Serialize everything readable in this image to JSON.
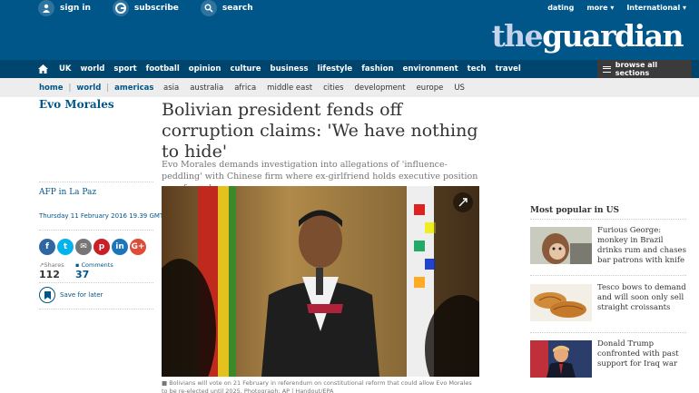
{
  "topnav": {
    "sign_in": "sign in",
    "subscribe": "subscribe",
    "search": "search",
    "dating": "dating",
    "more": "more",
    "international": "International"
  },
  "logo": {
    "the": "the",
    "guardian": "guardian"
  },
  "sections": [
    "UK",
    "world",
    "sport",
    "football",
    "opinion",
    "culture",
    "business",
    "lifestyle",
    "fashion",
    "environment",
    "tech",
    "travel"
  ],
  "browse_all": "browse all sections",
  "breadcrumb": [
    "home",
    "world",
    "americas"
  ],
  "subsections": [
    "asia",
    "australia",
    "africa",
    "middle east",
    "cities",
    "development",
    "europe",
    "US"
  ],
  "article": {
    "keyword": "Evo Morales",
    "headline": "Bolivian president fends off corruption claims: 'We have nothing to hide'",
    "standfirst": "Evo Morales demands investigation into allegations of 'influence-peddling' with Chinese firm where ex-girlfriend holds executive position as referendum nears",
    "byline": "AFP in La Paz",
    "date": "Thursday 11 February 2016 19.39 GMT",
    "caption": "Bolivians will vote on 21 February in referendum on constitutional reform that could allow Evo Morales to be re-elected until 2025. Photograph: AP | Handout/EPA"
  },
  "share": {
    "buttons": [
      "f",
      "t",
      "✉",
      "p",
      "in",
      "G+"
    ],
    "colors": [
      "#3067a3",
      "#03b3ee",
      "#767676",
      "#cb1f27",
      "#1b75bb",
      "#dd4b39"
    ],
    "shares_label": "Shares",
    "shares_count": "112",
    "comments_label": "Comments",
    "comments_count": "37",
    "save_label": "Save for later"
  },
  "most_popular": {
    "title": "Most popular in US",
    "items": [
      {
        "text": "Furious George: monkey in Brazil drinks rum and chases bar patrons with knife",
        "thumb": "monkey"
      },
      {
        "text": "Tesco bows to demand and will soon only sell straight croissants",
        "thumb": "croissants"
      },
      {
        "text": "Donald Trump confronted with past support for Iraq war",
        "thumb": "trump"
      }
    ]
  },
  "colors": {
    "brand": "#005689",
    "nav": "#00456e",
    "browse": "#3b3b3b"
  }
}
